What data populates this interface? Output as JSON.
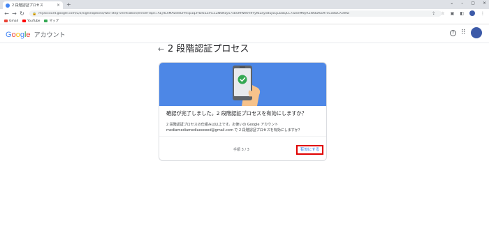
{
  "browser": {
    "tab_title": "2 段階認証プロセス",
    "tab_close": "×",
    "new_tab": "+",
    "window_controls": [
      "⌄",
      "–",
      "▢",
      "×"
    ],
    "url": "myaccount.google.com/u/2/signinoptions/two-step-verification/enroll?rapt=AEjHL4MAwd4GPmcp1q3YDl65ZmC1ZN6Nzy57xbSRfWetm9YyNi2ayvBuj5EjLzzaQLC7zzxeMNyRZWBDKoAt-SCo8wCA3Ww",
    "bookmarks": [
      {
        "label": "Gmail",
        "color": "#ea4335"
      },
      {
        "label": "YouTube",
        "color": "#ff0000"
      },
      {
        "label": "マップ",
        "color": "#34a853"
      }
    ]
  },
  "header": {
    "logo_letters": [
      "G",
      "o",
      "o",
      "g",
      "l",
      "e"
    ],
    "account_label": "アカウント",
    "help_label": "?",
    "apps_label": "⋮⋮"
  },
  "page": {
    "back_label": "←",
    "title": "2 段階認証プロセス"
  },
  "card": {
    "title": "確認が完了しました。2 段階認証プロセスを有効にしますか？",
    "desc_line1": "2 段階認証プロセスの仕組みは以上です。お使いの Google アカウント",
    "desc_line2": "mediamediamediaexceed@gmail.com で 2 段階認証プロセスを有効にしますか？",
    "step": "手順 3 / 3",
    "enable_button": "有効にする",
    "hero_color": "#4d87e6"
  }
}
